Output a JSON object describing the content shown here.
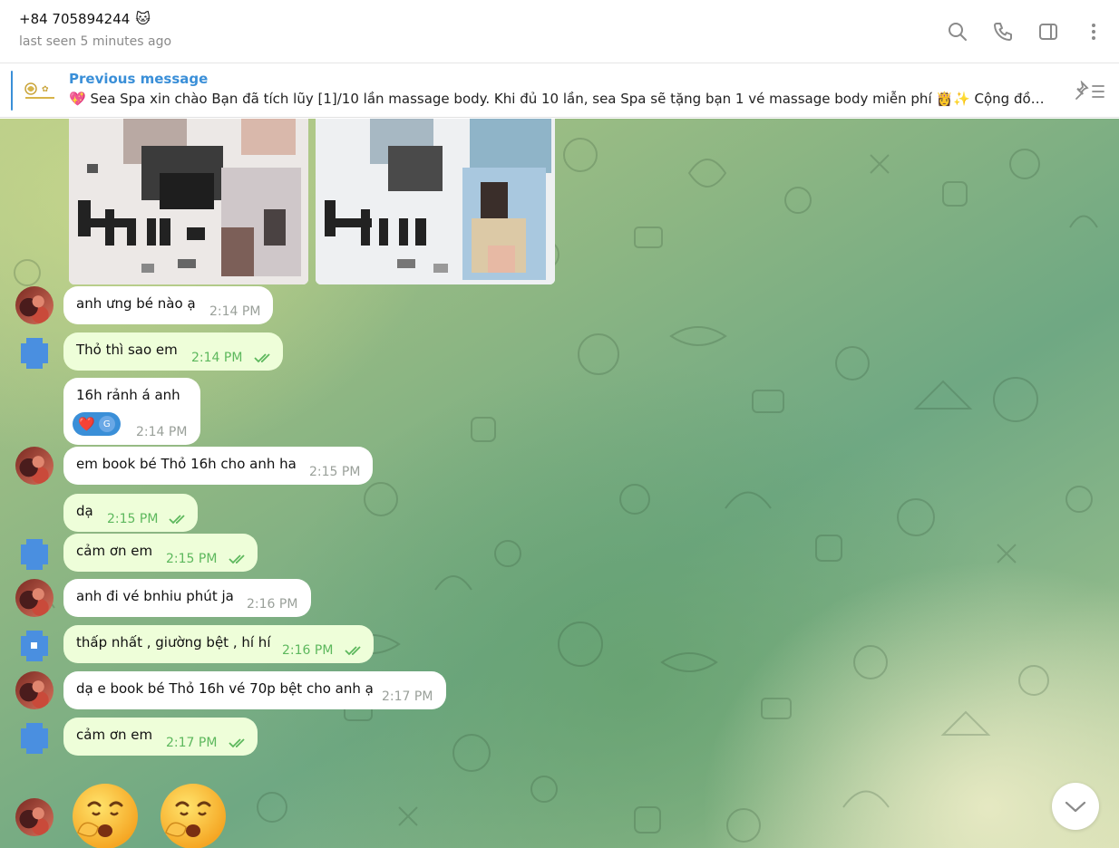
{
  "header": {
    "contact_name": "+84 705894244",
    "contact_emoji": "🐱",
    "status": "last seen 5 minutes ago",
    "actions": [
      {
        "name": "search-icon"
      },
      {
        "name": "phone-icon"
      },
      {
        "name": "sidebar-toggle-icon"
      },
      {
        "name": "more-vertical-icon"
      }
    ]
  },
  "pinned": {
    "title": "Previous message",
    "text": "💖 Sea Spa xin chào Bạn đã tích lũy [1]/10 lần massage body. Khi đủ 10 lần, sea Spa sẽ tặng bạn 1 vé massage body miễn phí 👸✨  Cộng đồn…",
    "logo_icon": "sea-spa-logo"
  },
  "messages": [
    {
      "dir": "in",
      "text": "anh ưng bé nào ạ",
      "time": "2:14 PM"
    },
    {
      "dir": "out",
      "text": "Thỏ thì sao em",
      "time": "2:14 PM"
    },
    {
      "dir": "in",
      "text": "16h rảnh á anh",
      "time": "2:14 PM",
      "reaction": {
        "emoji": "❤️",
        "user_initial": "G"
      }
    },
    {
      "dir": "in",
      "text": "em book bé Thỏ 16h cho anh ha",
      "time": "2:15 PM"
    },
    {
      "dir": "out",
      "text": "dạ",
      "time": "2:15 PM"
    },
    {
      "dir": "out",
      "text": "cảm ơn em",
      "time": "2:15 PM"
    },
    {
      "dir": "in",
      "text": "anh đi vé bnhiu phút ja",
      "time": "2:16 PM"
    },
    {
      "dir": "out",
      "text": "thấp nhất , giường bệt , hí hí",
      "time": "2:16 PM"
    },
    {
      "dir": "in",
      "text": "dạ e book bé Thỏ 16h vé 70p bệt cho anh ạ",
      "time": "2:17 PM"
    },
    {
      "dir": "out",
      "text": "cảm ơn em",
      "time": "2:17 PM"
    }
  ],
  "stickers": [
    "yawning-face-sticker",
    "yawning-face-sticker"
  ],
  "colors": {
    "accent": "#3a8fd8",
    "outgoing_bubble": "#eefed9",
    "incoming_bubble": "#ffffff",
    "read_ticks": "#5db85d"
  }
}
